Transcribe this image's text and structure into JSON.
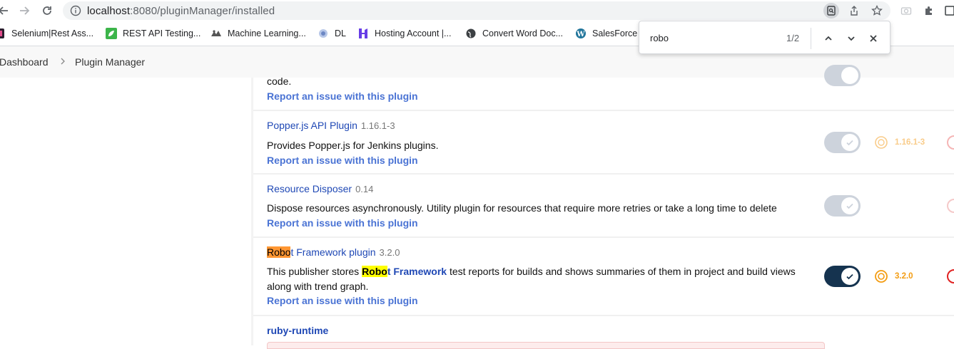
{
  "browser": {
    "url_host": "localhost",
    "url_path": ":8080/pluginManager/installed",
    "bookmarks": [
      {
        "label": "Selenium|Rest Ass...",
        "icon": "selenium-icon"
      },
      {
        "label": "REST API Testing...",
        "icon": "leaf-icon"
      },
      {
        "label": "Machine Learning...",
        "icon": "ml-icon"
      },
      {
        "label": "DL",
        "icon": "dl-icon"
      },
      {
        "label": "Hosting Account |...",
        "icon": "hostinger-icon"
      },
      {
        "label": "Convert Word Doc...",
        "icon": "globe-icon"
      },
      {
        "label": "SalesForce",
        "icon": "wordpress-icon"
      }
    ]
  },
  "find_bar": {
    "query": "robo",
    "count": "1/2"
  },
  "breadcrumb": {
    "items": [
      "Dashboard",
      "Plugin Manager"
    ],
    "separator": ">"
  },
  "plugins": [
    {
      "desc_tail": "code.",
      "report_link": "Report an issue with this plugin"
    },
    {
      "name": "Popper.js API Plugin",
      "version": "1.16.1-3",
      "description": "Provides Popper.js for Jenkins plugins.",
      "report_link": "Report an issue with this plugin",
      "enabled": true,
      "downgrade_version": "1.16.1-3"
    },
    {
      "name": "Resource Disposer",
      "version": "0.14",
      "description": "Dispose resources asynchronously. Utility plugin for resources that require more retries or take a long time to delete",
      "report_link": "Report an issue with this plugin",
      "enabled": true
    },
    {
      "name_highlight": "Robo",
      "name_rest": "t Framework plugin",
      "version": "3.2.0",
      "desc_before": "This publisher stores ",
      "desc_link_highlight": "Robo",
      "desc_link_rest": "t Framework",
      "desc_after": " test reports for builds and shows summaries of them in project and build views along with trend graph.",
      "report_link": "Report an issue with this plugin",
      "enabled": true,
      "downgrade_version": "3.2.0"
    },
    {
      "name": "ruby-runtime"
    }
  ],
  "colors": {
    "link": "#1f48b5",
    "report_link": "#4a73d4",
    "toggle_on": "#15334f",
    "toggle_off": "#cdd3dc",
    "downgrade_orange": "#f39c12",
    "uninstall_red": "#e02020",
    "find_current_highlight": "#ff9632",
    "find_other_highlight": "#ffff00"
  }
}
